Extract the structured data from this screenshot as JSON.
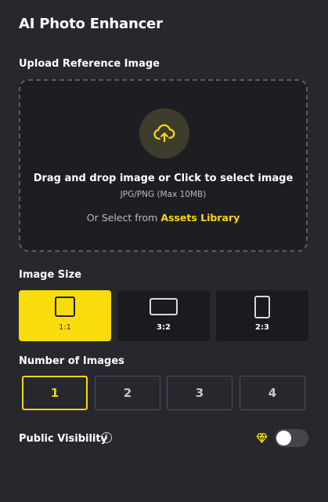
{
  "app": {
    "title": "AI Photo Enhancer"
  },
  "upload": {
    "label": "Upload Reference Image",
    "drop_text": "Drag and drop image or Click to select image",
    "format_hint": "JPG/PNG (Max 10MB)",
    "assets_prefix": "Or Select from",
    "assets_link": "Assets Library",
    "icon": "cloud-upload-icon"
  },
  "image_size": {
    "label": "Image Size",
    "selected": "1:1",
    "options": [
      {
        "label": "1:1"
      },
      {
        "label": "3:2"
      },
      {
        "label": "2:3"
      }
    ]
  },
  "number_of_images": {
    "label": "Number of Images",
    "selected": "1",
    "options": [
      "1",
      "2",
      "3",
      "4"
    ]
  },
  "visibility": {
    "label": "Public Visibility",
    "info_icon": "info-icon",
    "premium_icon": "diamond-icon",
    "enabled": false
  },
  "colors": {
    "accent": "#f9dc0c",
    "background": "#27282d",
    "panel": "#1d1e22"
  }
}
